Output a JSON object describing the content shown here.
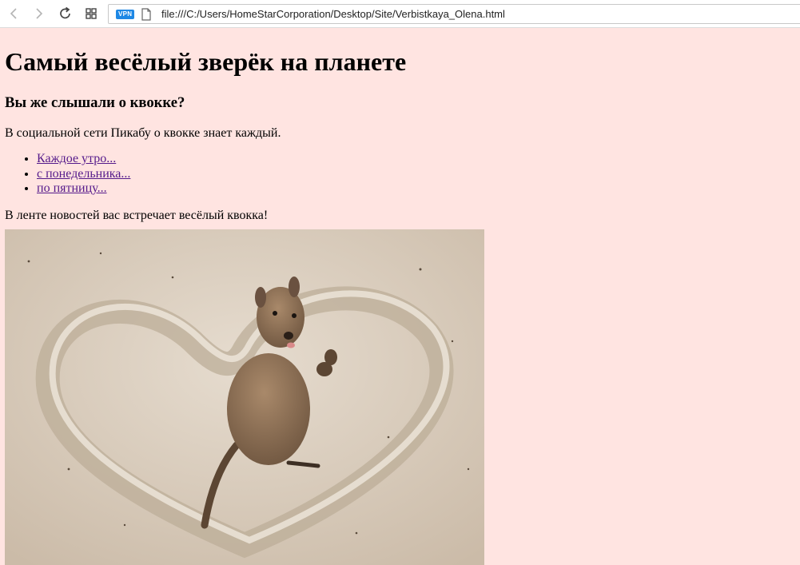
{
  "browser": {
    "vpn_badge": "VPN",
    "url": "file:///C:/Users/HomeStarCorporation/Desktop/Site/Verbistkaya_Olena.html"
  },
  "page": {
    "title": "Самый весёлый зверёк на планете",
    "subtitle": "Вы же слышали о квокке?",
    "intro": "В социальной сети Пикабу о квокке знает каждый.",
    "links": [
      "Каждое утро...",
      "с понедельника...",
      "по пятницу..."
    ],
    "outro": "В ленте новостей вас встречает весёлый квокка!",
    "image_subject": "quokka-on-sand-heart"
  },
  "colors": {
    "page_background": "#ffe4e1",
    "visited_link": "#551a8b",
    "vpn_badge": "#1e88e5"
  }
}
